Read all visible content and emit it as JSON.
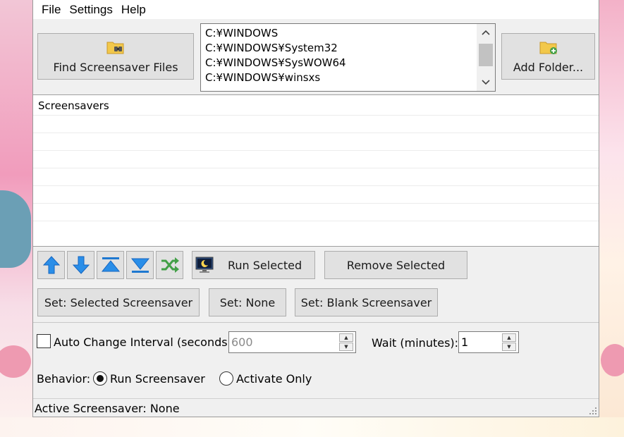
{
  "menu": {
    "items": [
      "File",
      "Settings",
      "Help"
    ]
  },
  "toolbar": {
    "find_label": "Find Screensaver Files",
    "add_folder_label": "Add Folder..."
  },
  "folders": [
    "C:¥WINDOWS",
    "C:¥WINDOWS¥System32",
    "C:¥WINDOWS¥SysWOW64",
    "C:¥WINDOWS¥winsxs"
  ],
  "screensavers": {
    "header": "Screensavers",
    "rows": []
  },
  "actions": {
    "run_selected": "Run Selected",
    "remove_selected": "Remove Selected",
    "set_selected": "Set: Selected Screensaver",
    "set_none": "Set: None",
    "set_blank": "Set: Blank Screensaver"
  },
  "options": {
    "auto_change_label": "Auto Change Interval (seconds):",
    "auto_change_checked": false,
    "auto_change_value": "600",
    "wait_label": "Wait (minutes):",
    "wait_value": "1",
    "behavior_label": "Behavior:",
    "behavior_options": [
      "Run Screensaver",
      "Activate Only"
    ],
    "behavior_selected": "Run Screensaver"
  },
  "status": {
    "text": "Active Screensaver: None"
  },
  "colors": {
    "accent_blue": "#1e88e5",
    "accent_green": "#43a047",
    "folder_yellow": "#f2c84b"
  }
}
